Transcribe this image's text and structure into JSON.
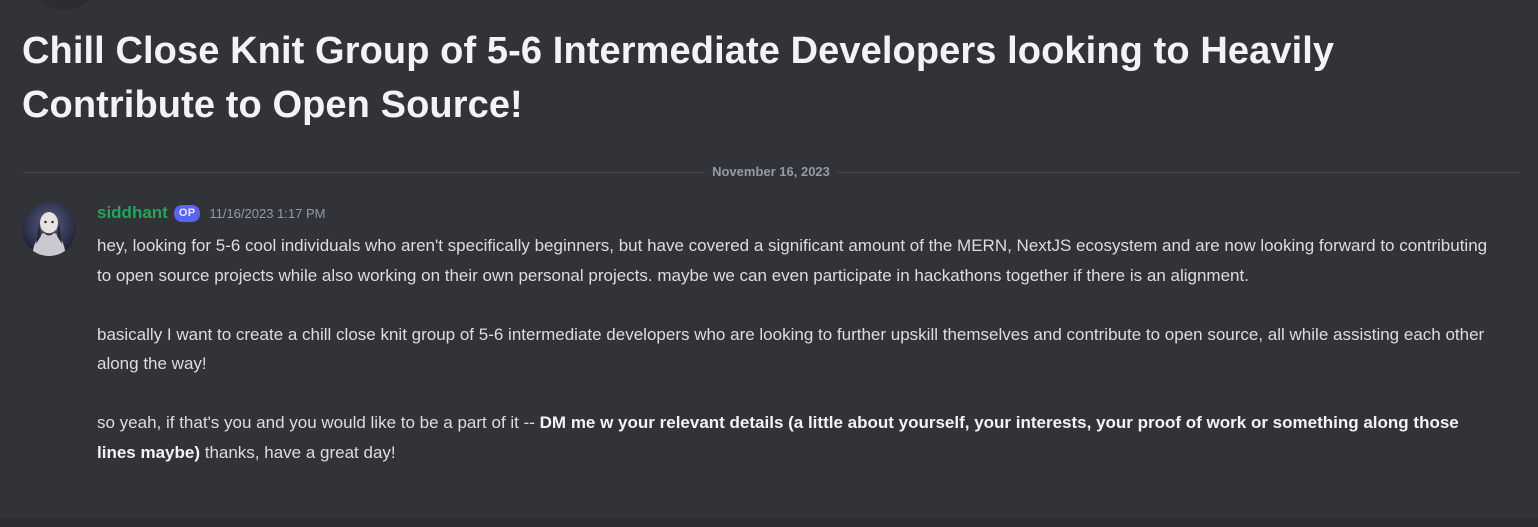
{
  "thread": {
    "title": "Chill Close Knit Group of 5-6 Intermediate Developers looking to Heavily Contribute to Open Source!"
  },
  "divider": {
    "date": "November 16, 2023"
  },
  "message": {
    "author": "siddhant",
    "badge": "OP",
    "timestamp": "11/16/2023 1:17 PM",
    "avatar_icon": "dark-portrait-avatar",
    "paragraphs": {
      "p1": "hey, looking for 5-6 cool individuals who aren't specifically beginners, but have covered a significant amount of the MERN, NextJS ecosystem and are now looking forward to contributing to open source projects while also working on their own personal projects. maybe we can even participate in hackathons together if there is an alignment.",
      "p2": "basically I want to create a chill close knit group of 5-6 intermediate developers who are looking to further upskill themselves and contribute to open source, all while assisting each other along the way!",
      "p3_lead": "so yeah, if that's you and you would like to be a part of it -- ",
      "p3_bold": "DM me w your relevant details (a little about yourself, your interests, your proof of work or something along those lines maybe)",
      "p3_tail": " thanks, have a great day!"
    }
  },
  "colors": {
    "background": "#313338",
    "title": "#f2f3f5",
    "body_text": "#dbdee1",
    "muted": "#949ba4",
    "author": "#23a55a",
    "op_badge": "#5865f2"
  }
}
